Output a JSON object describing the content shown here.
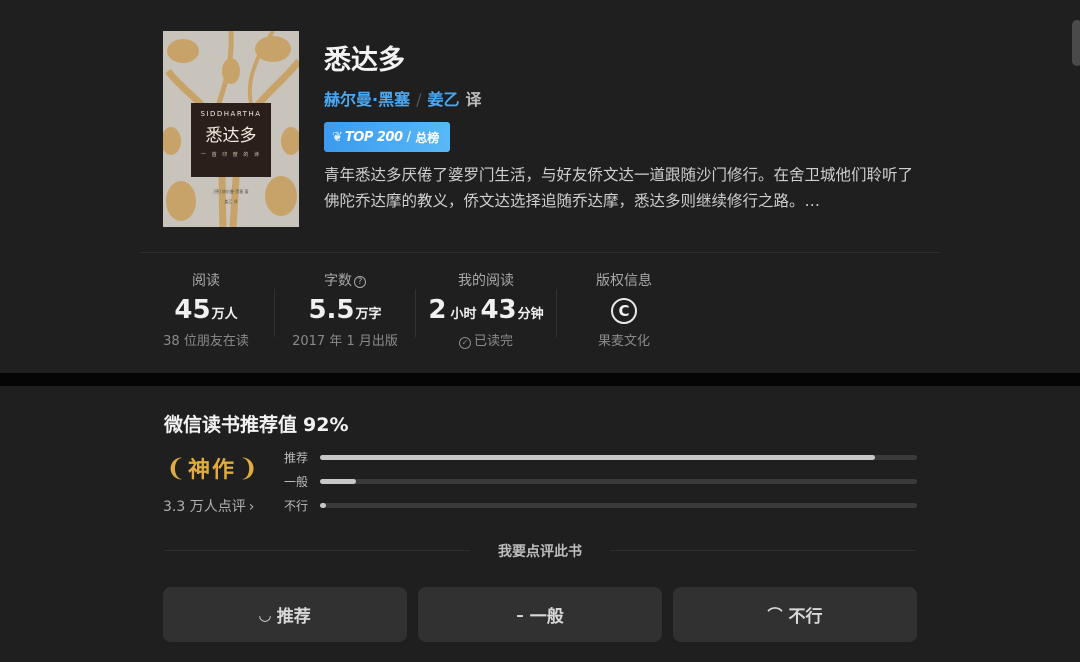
{
  "book": {
    "title": "悉达多",
    "author": "赫尔曼·黑塞",
    "separator": "/",
    "translator": "姜乙",
    "translator_suffix": "译",
    "badge": {
      "top_label": "TOP 200",
      "rank_label": "总榜"
    },
    "description": "青年悉达多厌倦了婆罗门生活，与好友侨文达一道跟随沙门修行。在舍卫城他们聆听了佛陀乔达摩的教义，侨文达选择追随乔达摩，悉达多则继续修行之路。…",
    "cover": {
      "en_title": "SIDDHARTHA",
      "cn_title": "悉达多",
      "subtitle": "一 首 印 度 的 诗",
      "line1": "[德] 赫尔曼·黑塞 著",
      "line2": "姜乙 译"
    }
  },
  "stats": {
    "reads": {
      "label": "阅读",
      "value": "45",
      "unit": "万人",
      "sub": "38 位朋友在读"
    },
    "words": {
      "label": "字数",
      "help": "?",
      "value": "5.5",
      "unit": "万字",
      "sub": "2017 年 1 月出版"
    },
    "my_reading": {
      "label": "我的阅读",
      "h": "2",
      "h_unit": "小时",
      "m": "43",
      "m_unit": "分钟",
      "check": "✓",
      "sub": "已读完"
    },
    "copyright": {
      "label": "版权信息",
      "icon": "C",
      "sub": "果麦文化"
    }
  },
  "recommendation": {
    "title": "微信读书推荐值",
    "percent": "92%",
    "grade": "神作",
    "review_count": "3.3 万人点评",
    "chevron": "›",
    "bars": [
      {
        "label": "推荐",
        "value": 0.93
      },
      {
        "label": "一般",
        "value": 0.06
      },
      {
        "label": "不行",
        "value": 0.01
      }
    ],
    "review_prompt": "我要点评此书",
    "buttons": [
      {
        "face": "◡",
        "label": "推荐"
      },
      {
        "face": "–",
        "label": "一般"
      },
      {
        "face": "⌒",
        "label": "不行"
      }
    ]
  },
  "colors": {
    "accent": "#4aa8f2",
    "gold": "#e0ac3c",
    "panel": "#1f1f1f"
  }
}
